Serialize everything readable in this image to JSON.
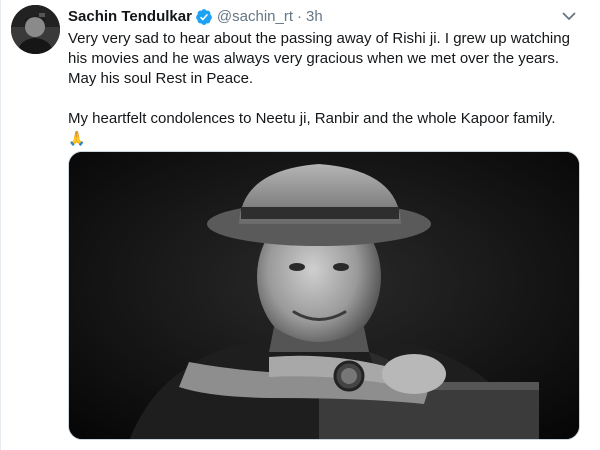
{
  "tweet": {
    "author": {
      "display_name": "Sachin Tendulkar",
      "handle": "@sachin_rt",
      "verified": true,
      "verified_icon": "verified-badge-icon"
    },
    "separator": "·",
    "timestamp": "3h",
    "menu_icon": "chevron-down-icon",
    "text_paragraphs": [
      "Very very sad to hear about the passing away of Rishi ji. I grew up watching his movies and he was always very gracious when we met over the years. May his soul Rest in Peace.",
      "My heartfelt condolences to Neetu ji, Ranbir and the whole Kapoor family."
    ],
    "emoji": "🙏",
    "media": {
      "type": "photo",
      "style": "black-and-white portrait"
    }
  },
  "colors": {
    "text_primary": "#14171a",
    "text_secondary": "#657786",
    "verified_blue": "#1da1f2",
    "border": "#e6ecf0"
  }
}
